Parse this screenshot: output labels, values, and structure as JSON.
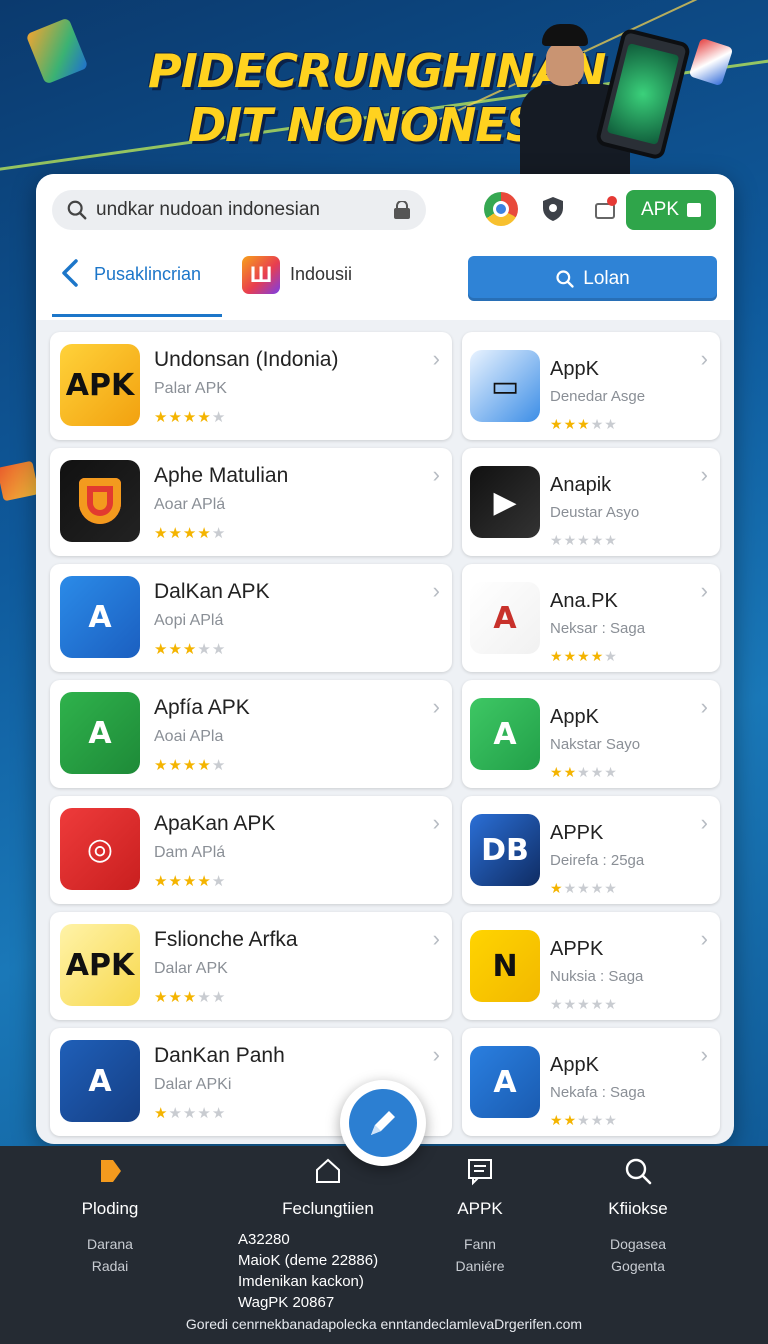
{
  "banner": {
    "title_line1": "PIDECRUNGHINAN",
    "title_line2": "DIT NONONES:AC"
  },
  "toolbar": {
    "search_value": "undkar nudoan indonesian",
    "apk_button_label": "APK"
  },
  "nav": {
    "back_label": "Pusaklincrian",
    "category_label": "Indousii",
    "category_logo_glyph": "Ш",
    "action_button_label": "Lolan"
  },
  "apps_left": [
    {
      "name": "Undonsan (Indonia)",
      "sub": "Palar APK",
      "icon_text": "APK",
      "stars": 4,
      "colors": [
        "#ffd23a",
        "#f2a10f"
      ]
    },
    {
      "name": "Aphe Matulian",
      "sub": "Aoar APlá",
      "icon_text": "",
      "stars": 4,
      "colors": [
        "#111111",
        "#222222"
      ]
    },
    {
      "name": "DalKan APK",
      "sub": "Aopi APlá",
      "icon_text": "A",
      "stars": 3,
      "colors": [
        "#2b8be8",
        "#1b5fc0"
      ]
    },
    {
      "name": "Apfía APK",
      "sub": "Aoai APla",
      "icon_text": "A",
      "stars": 4,
      "colors": [
        "#2fb24c",
        "#1e8a38"
      ]
    },
    {
      "name": "ApaKan APK",
      "sub": "Dam APlá",
      "icon_text": "◎",
      "stars": 4,
      "colors": [
        "#ee3b3b",
        "#c91f1f"
      ]
    },
    {
      "name": "Fslionche Arfka",
      "sub": "Dalar APK",
      "icon_text": "APK",
      "stars": 3,
      "colors": [
        "#fff3a8",
        "#f7d84e"
      ]
    },
    {
      "name": "DanKan Panh",
      "sub": "Dalar APKi",
      "icon_text": "A",
      "stars": 1,
      "colors": [
        "#1f5fb8",
        "#153f85"
      ]
    }
  ],
  "apps_right": [
    {
      "name": "AppK",
      "sub": "Denedar Asge",
      "icon_text": "▭",
      "stars": 3,
      "colors": [
        "#e9f3ff",
        "#3d8ee6"
      ]
    },
    {
      "name": "Anapik",
      "sub": "Deustar Asyo",
      "icon_text": "▶",
      "stars": 0,
      "colors": [
        "#111111",
        "#333333"
      ]
    },
    {
      "name": "Ana.PK",
      "sub": "Neksar : Saga",
      "icon_text": "A",
      "stars": 4,
      "colors": [
        "#ffffff",
        "#f1f1f1"
      ]
    },
    {
      "name": "AppK",
      "sub": "Nakstar Sayo",
      "icon_text": "A",
      "stars": 2,
      "colors": [
        "#3ec764",
        "#22a049"
      ]
    },
    {
      "name": "APPK",
      "sub": "Deirefa : 25ga",
      "icon_text": "DB",
      "stars": 1,
      "colors": [
        "#2b6fd6",
        "#0f2c63"
      ]
    },
    {
      "name": "APPK",
      "sub": "Nuksia : Saga",
      "icon_text": "N",
      "stars": 0,
      "colors": [
        "#ffd400",
        "#f2b800"
      ]
    },
    {
      "name": "AppK",
      "sub": "Nekafa : Saga",
      "icon_text": "A",
      "stars": 2,
      "colors": [
        "#2a7fe0",
        "#1a5bb0"
      ]
    }
  ],
  "bottom_nav": [
    {
      "label": "Ploding",
      "lines": [
        "Darana",
        "Radai"
      ]
    },
    {
      "label": "Feclungtiien",
      "lines": [
        "A32280",
        "MaioK (deme 22886)",
        "Imdenikan kackon)",
        "WagPK 20867"
      ]
    },
    {
      "label": "APPK",
      "lines": [
        "Fann",
        "Daniére"
      ]
    },
    {
      "label": "Kfiiokse",
      "lines": [
        "Dogasea",
        "Gogenta"
      ]
    }
  ],
  "footer": "Goredi cenrnekbanadapolecka enntandeclamlevaDrgerifen.com",
  "colors": {
    "accent": "#2f83d6",
    "apk_green": "#2fa54a",
    "star": "#f4b400",
    "title_yellow": "#ffd21f"
  }
}
